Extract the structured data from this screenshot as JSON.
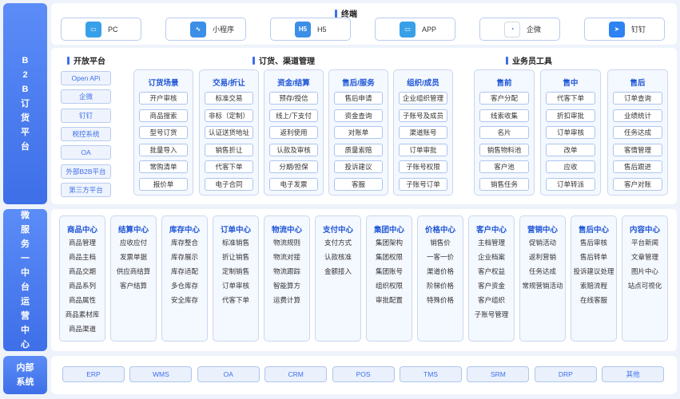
{
  "sidebar": {
    "b2b": "B2B订货平台",
    "micro": "微服务一中台运营中心",
    "internal": "内部系统"
  },
  "terminal": {
    "title": "终端",
    "items": [
      {
        "label": "PC",
        "icon": "monitor-icon",
        "color": "#38a0e8"
      },
      {
        "label": "小程序",
        "icon": "miniprogram-icon",
        "color": "#3c8ee6"
      },
      {
        "label": "H5",
        "icon": "h5-icon",
        "color": "#3c8ee6"
      },
      {
        "label": "APP",
        "icon": "monitor-icon",
        "color": "#38a0e8"
      },
      {
        "label": "企微",
        "icon": "wecom-icon",
        "color": "#ffffff"
      },
      {
        "label": "钉钉",
        "icon": "dingtalk-icon",
        "color": "#2d83f1"
      }
    ]
  },
  "open_platform": {
    "title": "开放平台",
    "items": [
      "Open APi",
      "企微",
      "钉钉",
      "税控系统",
      "OA",
      "外部B2B平台",
      "第三方平台"
    ]
  },
  "order_channel": {
    "title": "订货、渠道管理",
    "columns": [
      {
        "header": "订货场景",
        "items": [
          "开户审核",
          "商品搜索",
          "型号订货",
          "批量导入",
          "常购清单",
          "报价单"
        ]
      },
      {
        "header": "交易/折让",
        "items": [
          "标准交易",
          "非标（定制）",
          "认证送货地址",
          "销售折让",
          "代客下单",
          "电子合同"
        ]
      },
      {
        "header": "资金/结算",
        "items": [
          "预存/授信",
          "线上/下支付",
          "返利使用",
          "认款及审核",
          "分期/担保",
          "电子发票"
        ]
      },
      {
        "header": "售后/服务",
        "items": [
          "售后申请",
          "资金查询",
          "对账单",
          "质量索赔",
          "投诉建议",
          "客服"
        ]
      },
      {
        "header": "组织/成员",
        "items": [
          "企业组织管理",
          "子账号及成员",
          "渠道账号",
          "订单审批",
          "子账号权限",
          "子账号订单"
        ]
      }
    ]
  },
  "sales_tools": {
    "title": "业务员工具",
    "columns": [
      {
        "header": "售前",
        "items": [
          "客户分配",
          "线索收集",
          "名片",
          "销售物料池",
          "客户池",
          "销售任务"
        ]
      },
      {
        "header": "售中",
        "items": [
          "代客下单",
          "折扣审批",
          "订单审核",
          "改单",
          "应收",
          "订单转派"
        ]
      },
      {
        "header": "售后",
        "items": [
          "订单查询",
          "业绩统计",
          "任务达成",
          "客情管理",
          "售后跟进",
          "客户对账"
        ]
      }
    ]
  },
  "middle": {
    "columns": [
      {
        "header": "商品中心",
        "items": [
          "商品管理",
          "商品主档",
          "商品交期",
          "商品系列",
          "商品属性",
          "商品素材库",
          "商品渠道"
        ]
      },
      {
        "header": "结算中心",
        "items": [
          "应收应付",
          "发票单据",
          "供应商结算",
          "客户结算"
        ]
      },
      {
        "header": "库存中心",
        "items": [
          "库存整合",
          "库存展示",
          "库存适配",
          "多仓库存",
          "安全库存"
        ]
      },
      {
        "header": "订单中心",
        "items": [
          "标准销售",
          "折让销售",
          "定制销售",
          "订单审核",
          "代客下单"
        ]
      },
      {
        "header": "物流中心",
        "items": [
          "物流规则",
          "物流对接",
          "物流跟踪",
          "智能算方",
          "运费计算"
        ]
      },
      {
        "header": "支付中心",
        "items": [
          "支付方式",
          "认款核准",
          "金额接入"
        ]
      },
      {
        "header": "集团中心",
        "items": [
          "集团架构",
          "集团权限",
          "集团账号",
          "组织权限",
          "审批配置"
        ]
      },
      {
        "header": "价格中心",
        "items": [
          "销售价",
          "一客一价",
          "渠道价格",
          "阶梯价格",
          "特殊价格"
        ]
      },
      {
        "header": "客户中心",
        "items": [
          "主档管理",
          "企业档案",
          "客户权益",
          "客户资金",
          "客户组织",
          "子账号管理"
        ]
      },
      {
        "header": "营销中心",
        "items": [
          "促销活动",
          "返利营销",
          "任务达成",
          "常规营销活动"
        ]
      },
      {
        "header": "售后中心",
        "items": [
          "售后审核",
          "售后转单",
          "投诉建议处理",
          "索赔流程",
          "在线客服"
        ]
      },
      {
        "header": "内容中心",
        "items": [
          "平台新闻",
          "文章管理",
          "图片中心",
          "站点可视化"
        ]
      }
    ]
  },
  "internal": {
    "items": [
      "ERP",
      "WMS",
      "OA",
      "CRM",
      "POS",
      "TMS",
      "SRM",
      "DRP",
      "其他"
    ]
  }
}
